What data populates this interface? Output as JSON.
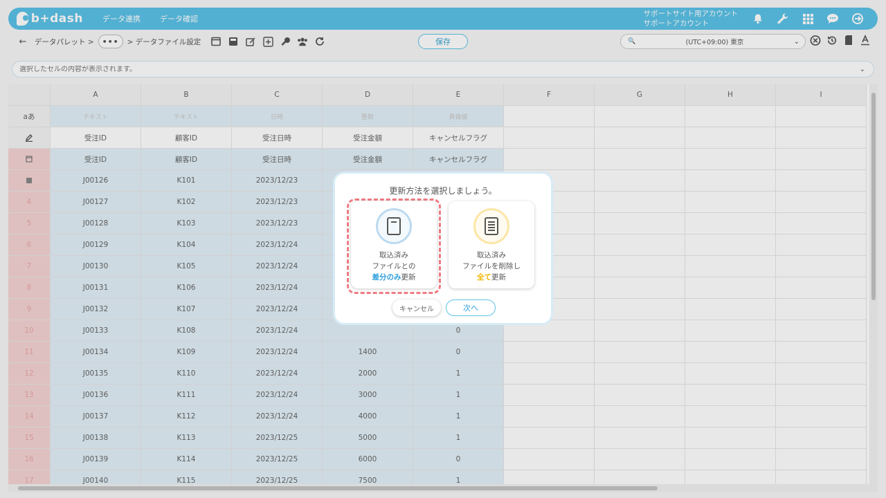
{
  "header": {
    "brand": "b+dash",
    "nav": [
      "データ連携",
      "データ確認"
    ],
    "account_line1": "サポートサイト用アカウント",
    "account_line2": "サポートアカウント",
    "icons": [
      "bell-icon",
      "wrench-icon",
      "grid-icon",
      "chat-icon",
      "logout-icon"
    ]
  },
  "toolbar": {
    "back": "←",
    "crumb1": "データパレット >",
    "dots": "•••",
    "crumb2": "> データファイル設定",
    "save_label": "保存",
    "timezone": "(UTC+09:00) 東京",
    "mag": "🔍"
  },
  "cellbar": {
    "placeholder": "選択したセルの内容が表示されます。"
  },
  "grid": {
    "columns": [
      "A",
      "B",
      "C",
      "D",
      "E",
      "F",
      "G",
      "H",
      "I"
    ],
    "type_row_label": "aあ",
    "types": [
      "テキスト",
      "テキスト",
      "日時",
      "整数",
      "真偽値"
    ],
    "headers": [
      "受注ID",
      "顧客ID",
      "受注日時",
      "受注金額",
      "キャンセルフラグ"
    ],
    "rows": [
      {
        "n": "4",
        "a": "J00126",
        "b": "K101",
        "c": "2023/12/23",
        "d": "",
        "e": ""
      },
      {
        "n": "4",
        "a": "J00127",
        "b": "K102",
        "c": "2023/12/23",
        "d": "",
        "e": ""
      },
      {
        "n": "5",
        "a": "J00128",
        "b": "K103",
        "c": "2023/12/23",
        "d": "",
        "e": ""
      },
      {
        "n": "6",
        "a": "J00129",
        "b": "K104",
        "c": "2023/12/24",
        "d": "",
        "e": ""
      },
      {
        "n": "7",
        "a": "J00130",
        "b": "K105",
        "c": "2023/12/24",
        "d": "",
        "e": ""
      },
      {
        "n": "8",
        "a": "J00131",
        "b": "K106",
        "c": "2023/12/24",
        "d": "",
        "e": ""
      },
      {
        "n": "9",
        "a": "J00132",
        "b": "K107",
        "c": "2023/12/24",
        "d": "",
        "e": ""
      },
      {
        "n": "10",
        "a": "J00133",
        "b": "K108",
        "c": "2023/12/24",
        "d": "",
        "e": "0"
      },
      {
        "n": "11",
        "a": "J00134",
        "b": "K109",
        "c": "2023/12/24",
        "d": "1400",
        "e": "0"
      },
      {
        "n": "12",
        "a": "J00135",
        "b": "K110",
        "c": "2023/12/24",
        "d": "2000",
        "e": "1"
      },
      {
        "n": "13",
        "a": "J00136",
        "b": "K111",
        "c": "2023/12/24",
        "d": "3000",
        "e": "1"
      },
      {
        "n": "14",
        "a": "J00137",
        "b": "K112",
        "c": "2023/12/24",
        "d": "4000",
        "e": "1"
      },
      {
        "n": "15",
        "a": "J00138",
        "b": "K113",
        "c": "2023/12/25",
        "d": "5000",
        "e": "1"
      },
      {
        "n": "16",
        "a": "J00139",
        "b": "K114",
        "c": "2023/12/25",
        "d": "6000",
        "e": "0"
      },
      {
        "n": "17",
        "a": "J00140",
        "b": "K115",
        "c": "2023/12/25",
        "d": "7500",
        "e": "1"
      }
    ]
  },
  "modal": {
    "title": "更新方法を選択しましょう。",
    "option1": {
      "line1": "取込済み",
      "line2": "ファイルとの",
      "emph": "差分のみ",
      "tail": "更新"
    },
    "option2": {
      "line1": "取込済み",
      "line2": "ファイルを削除し",
      "emph": "全て",
      "tail": "更新"
    },
    "cancel_label": "キャンセル",
    "next_label": "次へ"
  }
}
